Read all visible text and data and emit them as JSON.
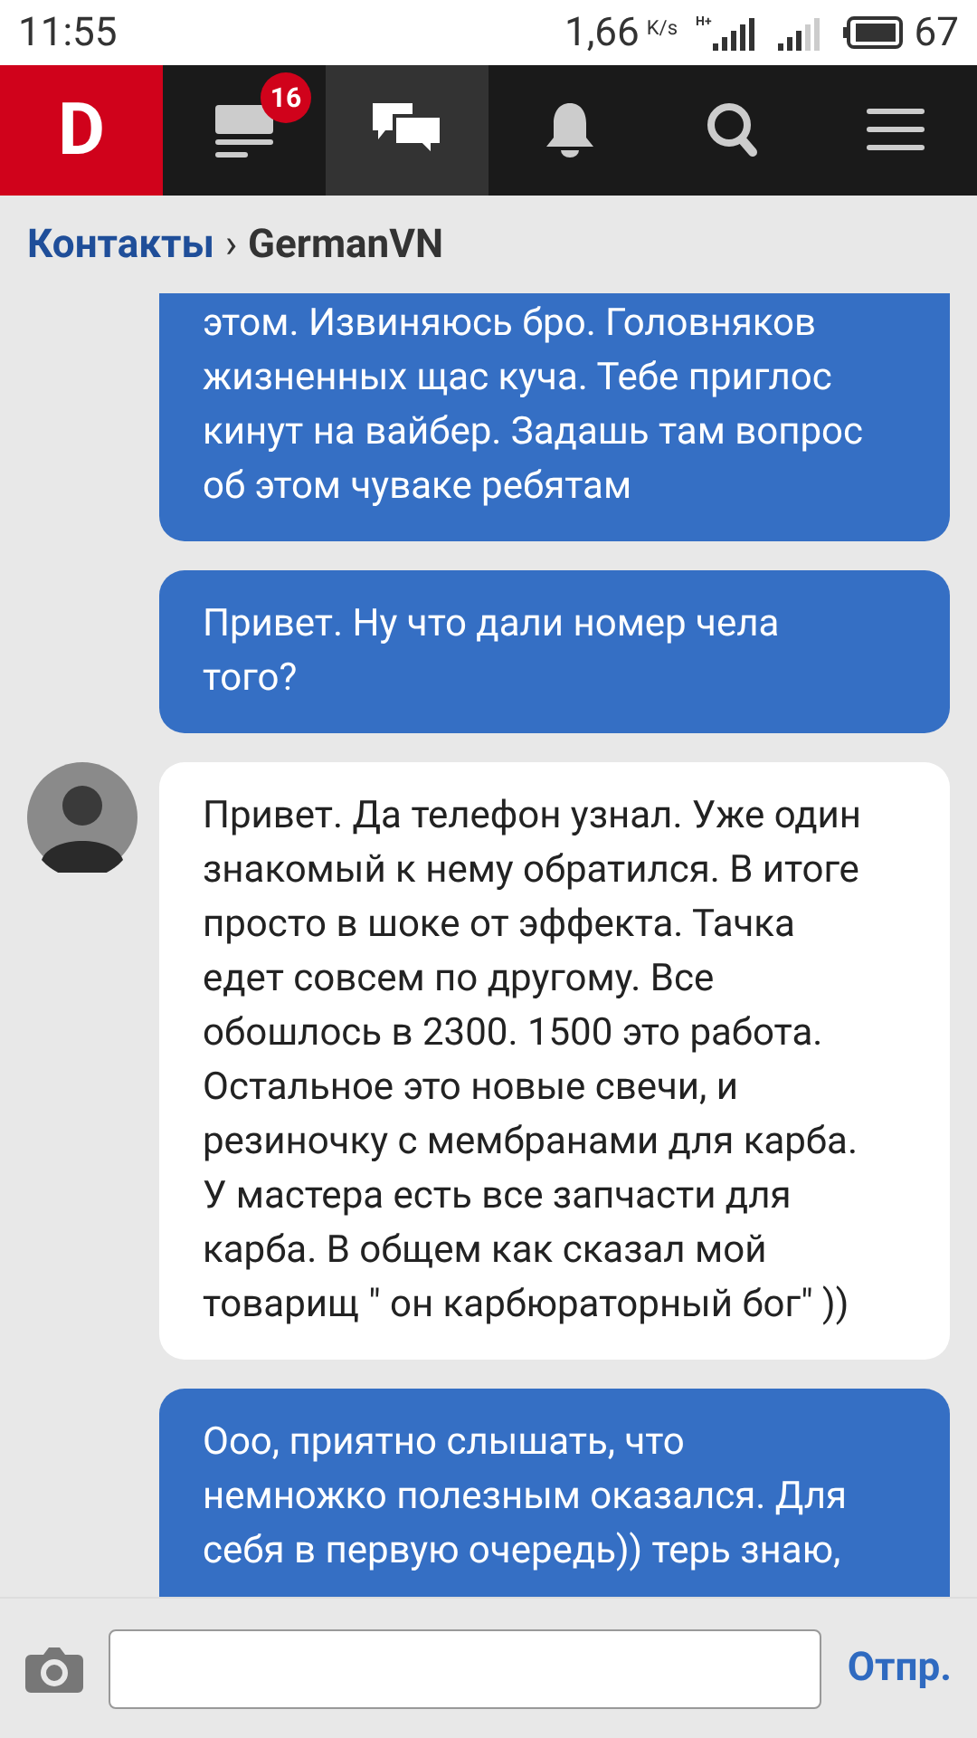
{
  "status_bar": {
    "time": "11:55",
    "speed": "1,66",
    "speed_unit": "K/s",
    "network": "H+",
    "battery": "67"
  },
  "nav": {
    "logo": "D",
    "items": [
      {
        "kind": "feed",
        "badge": "16",
        "selected": false
      },
      {
        "kind": "messages",
        "selected": true
      },
      {
        "kind": "notifications",
        "selected": false
      },
      {
        "kind": "search",
        "selected": false
      },
      {
        "kind": "menu",
        "selected": false
      }
    ]
  },
  "breadcrumb": {
    "parent": "Контакты",
    "separator": "›",
    "current": "GermanVN"
  },
  "messages": [
    {
      "kind": "outgoing",
      "text": "этом. Извиняюсь бро. Головняков жизненных щас куча. Тебе приглос кинут на вайбер. Задашь там вопрос об этом чуваке ребятам",
      "cut_top": true,
      "cut_bottom": false
    },
    {
      "kind": "outgoing",
      "text": "Привет. Ну что дали номер чела того?",
      "cut_top": false,
      "cut_bottom": false
    },
    {
      "kind": "incoming",
      "text": "Привет. Да телефон узнал. Уже один знакомый к нему обратился. В итоге просто в шоке от эффекта. Тачка едет совсем по другому. Все обошлось в 2300. 1500 это работа. Остальное это новые свечи, и резиночку с мембранами для карба. У мастера есть все запчасти для карба. В общем как сказал мой товарищ \" он карбюраторный бог\" ))",
      "cut_top": false,
      "cut_bottom": false
    },
    {
      "kind": "outgoing",
      "text": "Ооо, приятно слышать, что немножко полезным оказался. Для себя в первую очередь)) терь знаю,",
      "cut_top": false,
      "cut_bottom": true
    }
  ],
  "composer": {
    "send": "Отпр."
  }
}
